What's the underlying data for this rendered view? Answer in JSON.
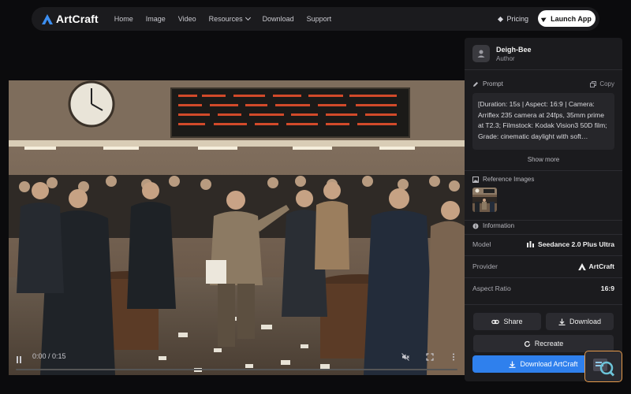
{
  "brand": {
    "name": "ArtCraft",
    "accent": "#2f80ed"
  },
  "nav": {
    "items": [
      "Home",
      "Image",
      "Video",
      "Resources",
      "Download",
      "Support"
    ],
    "pricing": "Pricing",
    "launch": "Launch App"
  },
  "video": {
    "timecode": "0:00 / 0:15",
    "progress": 0.0
  },
  "author": {
    "name": "Deigh-Bee",
    "role": "Author"
  },
  "prompt": {
    "title": "Prompt",
    "copy": "Copy",
    "text": "[Duration: 15s | Aspect: 16:9 | Camera: Arriflex 235 camera at 24fps, 35mm prime at T2.3; Filmstock: Kodak Vision3 50D film; Grade: cinematic daylight with soft…",
    "show_more": "Show more"
  },
  "reference": {
    "title": "Reference Images"
  },
  "information": {
    "title": "Information",
    "rows": [
      {
        "key": "Model",
        "value": "Seedance 2.0 Plus Ultra",
        "icon": "bars-icon"
      },
      {
        "key": "Provider",
        "value": "ArtCraft",
        "icon": "artcraft-logo-icon"
      },
      {
        "key": "Aspect Ratio",
        "value": "16:9"
      }
    ]
  },
  "actions": {
    "share": "Share",
    "download": "Download",
    "recreate": "Recreate",
    "download_app": "Download ArtCraft"
  }
}
